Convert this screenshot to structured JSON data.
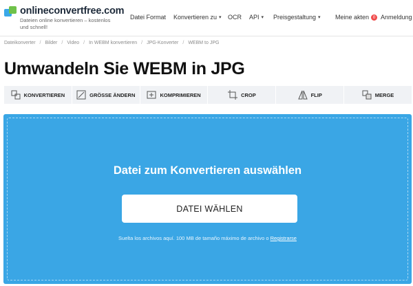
{
  "header": {
    "logo_title": "onlineconvertfree.com",
    "logo_tagline": "Dateien online konvertieren – kostenlos und schnell!",
    "nav": [
      {
        "label": "Datei Format",
        "dropdown": false
      },
      {
        "label": "Konvertieren zu",
        "dropdown": true
      },
      {
        "label": "OCR",
        "dropdown": false
      },
      {
        "label": "API",
        "dropdown": true
      },
      {
        "label": "Preisgestaltung",
        "dropdown": true
      }
    ],
    "my_files_label": "Meine akten",
    "my_files_count": "0",
    "login_label": "Anmeldung"
  },
  "breadcrumb": [
    "Dateikonverter",
    "Bilder",
    "Video",
    "In WEBM konvertieren",
    "JPG-Konverter",
    "WEBM to JPG"
  ],
  "page_title": "Umwandeln Sie WEBM in JPG",
  "tools": [
    {
      "label": "KONVERTIEREN",
      "icon": "convert-icon"
    },
    {
      "label": "GRÖSSE ÄNDERN",
      "icon": "resize-icon"
    },
    {
      "label": "KOMPRIMIEREN",
      "icon": "compress-icon"
    },
    {
      "label": "CROP",
      "icon": "crop-icon"
    },
    {
      "label": "FLIP",
      "icon": "flip-icon"
    },
    {
      "label": "MERGE",
      "icon": "merge-icon"
    }
  ],
  "upload": {
    "title": "Datei zum Konvertieren auswählen",
    "button_label": "DATEI WÄHLEN",
    "note_text": "Suelta los archivos aquí. 100 MB de tamaño máximo de archivo o ",
    "register_link": "Registrarse"
  },
  "colors": {
    "upload_bg": "#3aa6e5",
    "badge": "#f04a4a",
    "logo_blue": "#3aa8e8",
    "logo_green": "#6fc24a"
  }
}
